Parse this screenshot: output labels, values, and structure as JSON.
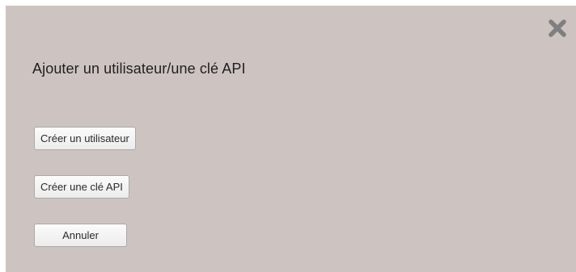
{
  "dialog": {
    "title": "Ajouter un utilisateur/une clé API",
    "close_icon": "close-x-icon",
    "buttons": {
      "create_user": "Créer un utilisateur",
      "create_api_key": "Créer une clé API",
      "cancel": "Annuler"
    }
  },
  "colors": {
    "dialog_background": "#cdc4c1",
    "close_icon": "#7f7f7f"
  }
}
